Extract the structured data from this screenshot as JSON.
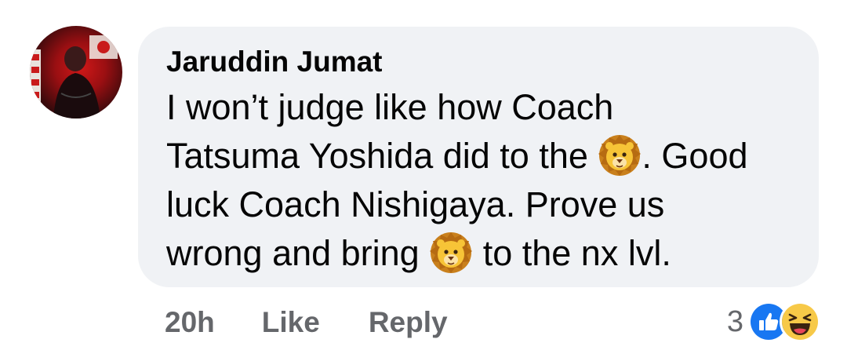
{
  "comment": {
    "author": "Jaruddin Jumat",
    "text_line1": "I won’t judge like how Coach",
    "text_line2_a": "Tatsuma Yoshida did to the ",
    "text_line2_b": ". Good",
    "text_line3": "luck Coach Nishigaya. Prove us",
    "text_line4_a": "wrong and bring ",
    "text_line4_b": " to the nx lvl.",
    "emoji_icon": "lion-face-emoji"
  },
  "footer": {
    "time": "20h",
    "like_label": "Like",
    "reply_label": "Reply"
  },
  "reactions": {
    "count": "3",
    "icons": [
      "like-reaction-icon",
      "haha-reaction-icon"
    ],
    "like_color": "#1877f2",
    "haha_color": "#f7c948"
  },
  "colors": {
    "bubble": "#f0f2f5",
    "text": "#050505",
    "muted": "#65676b"
  }
}
